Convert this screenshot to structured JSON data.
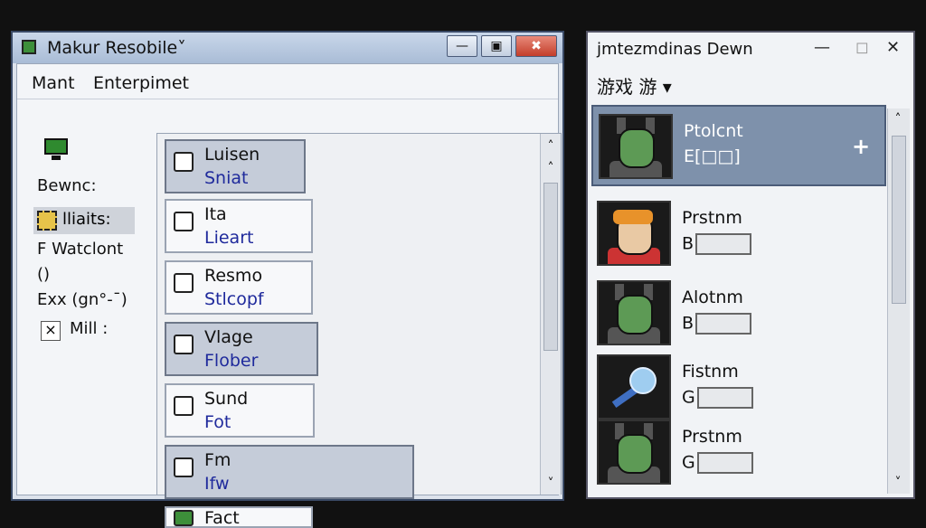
{
  "left_window": {
    "title": "Makur Resobile˅",
    "buttons": {
      "minimize": "—",
      "maximize": "▣",
      "close": "✖"
    },
    "menu": [
      "Mant",
      "Enterpimet"
    ],
    "sidebar": {
      "label1": "Bewnc:",
      "selected": "lliaits:",
      "label2": "F Watclont",
      "label3": "()",
      "label4": "Exx (gn°-ˉ)",
      "check_mark": "×",
      "check_label": "Mill :"
    },
    "list": [
      {
        "title": "Luisen",
        "sub": "Sniat",
        "selected": true
      },
      {
        "title": "Ita",
        "sub": "Lieart",
        "selected": false
      },
      {
        "title": "Resmo",
        "sub": "Stlcopf",
        "selected": false
      },
      {
        "title": "Vlage",
        "sub": "Flober",
        "selected": true
      },
      {
        "title": "Sund",
        "sub": "Fot",
        "selected": false
      },
      {
        "title": "Fm",
        "sub": "Ifw",
        "selected": true
      },
      {
        "title": "Fact",
        "sub": "",
        "selected": false
      }
    ],
    "scroll_up": "˄",
    "scroll_up2": "˄",
    "scroll_down": "˅"
  },
  "right_window": {
    "title": "jmtezmdinas Dewn",
    "controls": {
      "minimize": "—",
      "maximize": "◻",
      "close": "✕"
    },
    "tabs": "游戏 游 ▾",
    "players": [
      {
        "name": "Ptolcnt",
        "stat": "E[□□]",
        "selected": true,
        "avatar": "goblin"
      },
      {
        "name": "Prstnm",
        "stat": "B",
        "selected": false,
        "avatar": "human"
      },
      {
        "name": "Alotnm",
        "stat": "B",
        "selected": false,
        "avatar": "goblin"
      },
      {
        "name": "Fistnm",
        "stat": "G",
        "selected": false,
        "avatar": "orb"
      },
      {
        "name": "Prstnm",
        "stat": "G",
        "selected": false,
        "avatar": "goblin"
      }
    ],
    "plus": "+",
    "scroll_up": "˄",
    "scroll_down": "˅"
  },
  "colors": {
    "selection": "#7e91ab",
    "link_text": "#1f2a9c"
  }
}
